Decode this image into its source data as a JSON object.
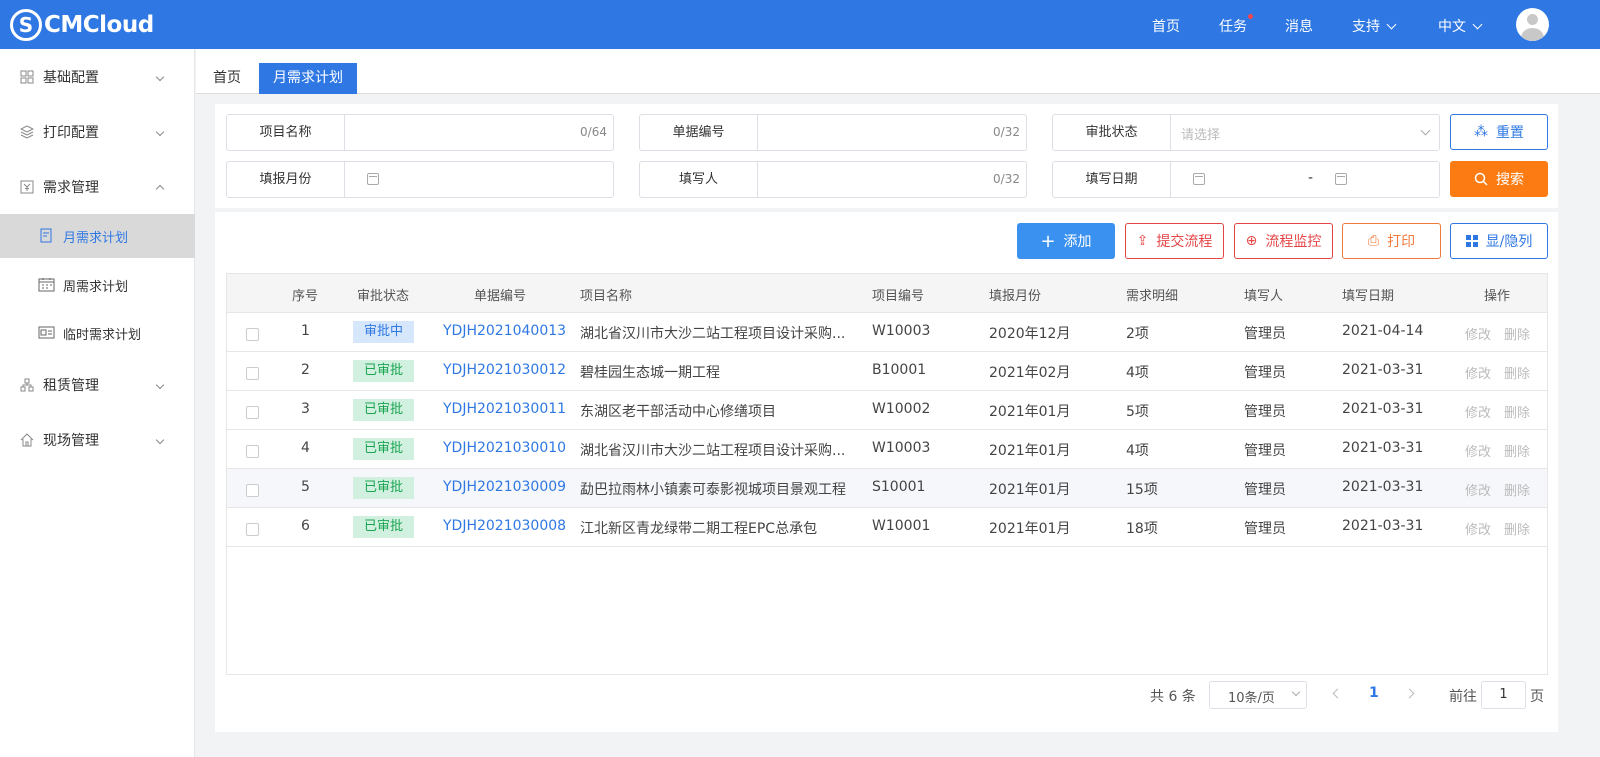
{
  "brand": {
    "logo_letter": "S",
    "name": "CMCloud"
  },
  "topnav": {
    "home": "首页",
    "tasks": "任务",
    "messages": "消息",
    "support": "支持",
    "language": "中文"
  },
  "sidebar": {
    "items": [
      {
        "label": "基础配置",
        "icon": "grid-icon"
      },
      {
        "label": "打印配置",
        "icon": "layers-icon"
      },
      {
        "label": "需求管理",
        "icon": "requirement-icon"
      },
      {
        "label": "租赁管理",
        "icon": "org-chart-icon"
      },
      {
        "label": "现场管理",
        "icon": "home-icon"
      }
    ],
    "subitems": [
      {
        "label": "月需求计划",
        "icon": "doc-icon"
      },
      {
        "label": "周需求计划",
        "icon": "calendar-icon"
      },
      {
        "label": "临时需求计划",
        "icon": "card-icon"
      }
    ]
  },
  "tabs": {
    "home": "首页",
    "active": "月需求计划"
  },
  "filters": {
    "project_name": {
      "label": "项目名称",
      "count": "0/64"
    },
    "doc_no": {
      "label": "单据编号",
      "count": "0/32"
    },
    "approval_status": {
      "label": "审批状态",
      "placeholder": "请选择"
    },
    "report_month": {
      "label": "填报月份"
    },
    "filler": {
      "label": "填写人",
      "count": "0/32"
    },
    "fill_date": {
      "label": "填写日期",
      "separator": "-"
    }
  },
  "buttons": {
    "reset": "重置",
    "search": "搜索",
    "add": "添加",
    "submit_flow": "提交流程",
    "monitor_flow": "流程监控",
    "print": "打印",
    "toggle_columns": "显/隐列"
  },
  "table": {
    "headers": [
      "序号",
      "审批状态",
      "单据编号",
      "项目名称",
      "项目编号",
      "填报月份",
      "需求明细",
      "填写人",
      "填写日期",
      "操作"
    ],
    "rows": [
      {
        "no": "1",
        "status": "审批中",
        "doc": "YDJH2021040013",
        "project": "湖北省汉川市大沙二站工程项目设计采购...",
        "code": "W10003",
        "month": "2020年12月",
        "detail": "2项",
        "filler": "管理员",
        "date": "2021-04-14",
        "edit": "修改",
        "del": "删除"
      },
      {
        "no": "2",
        "status": "已审批",
        "doc": "YDJH2021030012",
        "project": "碧桂园生态城一期工程",
        "code": "B10001",
        "month": "2021年02月",
        "detail": "4项",
        "filler": "管理员",
        "date": "2021-03-31",
        "edit": "修改",
        "del": "删除"
      },
      {
        "no": "3",
        "status": "已审批",
        "doc": "YDJH2021030011",
        "project": "东湖区老干部活动中心修缮项目",
        "code": "W10002",
        "month": "2021年01月",
        "detail": "5项",
        "filler": "管理员",
        "date": "2021-03-31",
        "edit": "修改",
        "del": "删除"
      },
      {
        "no": "4",
        "status": "已审批",
        "doc": "YDJH2021030010",
        "project": "湖北省汉川市大沙二站工程项目设计采购...",
        "code": "W10003",
        "month": "2021年01月",
        "detail": "4项",
        "filler": "管理员",
        "date": "2021-03-31",
        "edit": "修改",
        "del": "删除"
      },
      {
        "no": "5",
        "status": "已审批",
        "doc": "YDJH2021030009",
        "project": "勐巴拉雨林小镇素可泰影视城项目景观工程",
        "code": "S10001",
        "month": "2021年01月",
        "detail": "15项",
        "filler": "管理员",
        "date": "2021-03-31",
        "edit": "修改",
        "del": "删除"
      },
      {
        "no": "6",
        "status": "已审批",
        "doc": "YDJH2021030008",
        "project": "江北新区青龙绿带二期工程EPC总承包",
        "code": "W10001",
        "month": "2021年01月",
        "detail": "18项",
        "filler": "管理员",
        "date": "2021-03-31",
        "edit": "修改",
        "del": "删除"
      }
    ]
  },
  "pagination": {
    "total": "共 6 条",
    "page_size": "10条/页",
    "current": "1",
    "goto_prefix": "前往",
    "goto_value": "1",
    "goto_suffix": "页"
  },
  "colors": {
    "primary": "#2f78e4",
    "search": "#fc7c13",
    "danger": "#e54545",
    "approved": "#1aa552"
  }
}
